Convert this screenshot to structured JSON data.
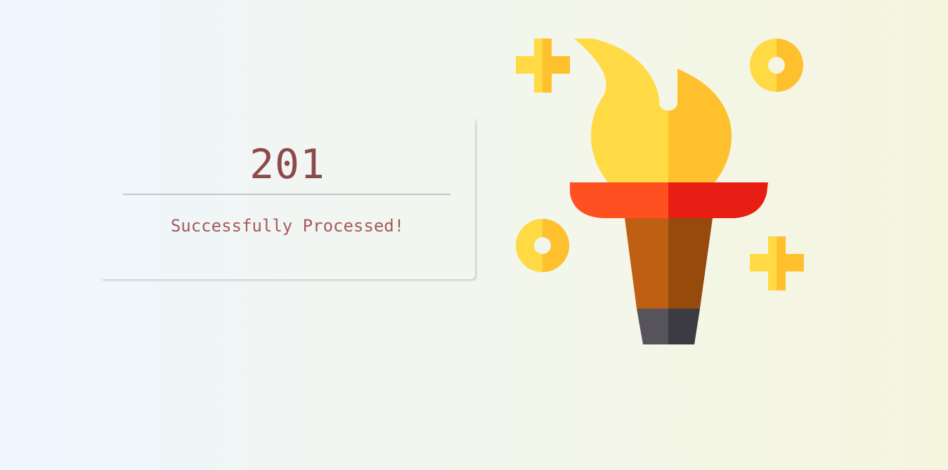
{
  "status": {
    "code": "201",
    "message": "Successfully Processed!"
  },
  "illustration": {
    "icon": "torch-icon",
    "decorations": [
      "plus-sparkle-icon",
      "ring-sparkle-icon",
      "ring-sparkle-icon",
      "plus-sparkle-icon"
    ]
  },
  "colors": {
    "code_text": "#8e4a4a",
    "message_text": "#a65a5a",
    "flame_light": "#ffda44",
    "flame_dark": "#ffc02e",
    "bowl_light": "#ff5022",
    "bowl_dark": "#e81e14",
    "handle_light": "#bf5f14",
    "handle_dark": "#964b0d",
    "base_light": "#56545a",
    "base_dark": "#3c3b41"
  }
}
